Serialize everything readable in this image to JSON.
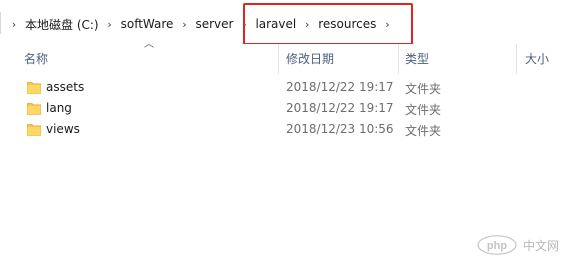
{
  "breadcrumb": {
    "items": [
      {
        "label": "本地磁盘 (C:)"
      },
      {
        "label": "softWare"
      },
      {
        "label": "server"
      },
      {
        "label": "laravel"
      },
      {
        "label": "resources"
      }
    ]
  },
  "columns": {
    "name": "名称",
    "date_modified": "修改日期",
    "type": "类型",
    "size": "大小"
  },
  "files": [
    {
      "name": "assets",
      "date": "2018/12/22 19:17",
      "type": "文件夹"
    },
    {
      "name": "lang",
      "date": "2018/12/22 19:17",
      "type": "文件夹"
    },
    {
      "name": "views",
      "date": "2018/12/23 10:56",
      "type": "文件夹"
    }
  ],
  "watermark": {
    "logo_text": "php",
    "text": "中文网"
  },
  "colors": {
    "highlight_box": "#e32222",
    "folder_yellow": "#f4c84a",
    "header_text": "#4d6082"
  }
}
